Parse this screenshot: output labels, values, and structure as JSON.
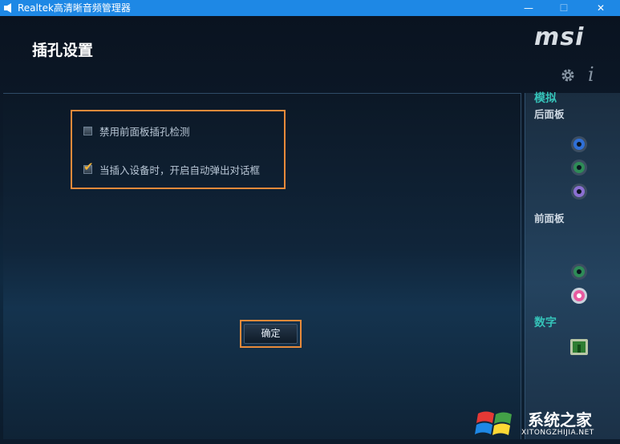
{
  "window": {
    "title": "Realtek高清晰音频管理器",
    "controls": {
      "minimize": "—",
      "maximize": "☐",
      "close": "✕"
    }
  },
  "page": {
    "title": "插孔设置"
  },
  "options": [
    {
      "label": "禁用前面板插孔检测",
      "checked": false
    },
    {
      "label": "当插入设备时，开启自动弹出对话框",
      "checked": true
    }
  ],
  "ok_button": {
    "label": "确定"
  },
  "logo": {
    "text": "msi"
  },
  "side_panel": {
    "analog_heading": "模拟",
    "rear_panel_label": "后面板",
    "rear_jacks": [
      "blue-jack-icon",
      "green-jack-icon",
      "purple-jack-icon"
    ],
    "front_panel_label": "前面板",
    "front_jacks": [
      "green-jack-icon",
      "pink-jack-icon"
    ],
    "digital_heading": "数字",
    "info_symbol": "i"
  },
  "colors": {
    "highlight_border": "#e88a3a",
    "accent_teal": "#35c2b8",
    "titlebar": "#1e88e5",
    "jack_blue": "#2f6fd6",
    "jack_green": "#2e8b57",
    "jack_purple": "#8a6fd1",
    "jack_pink": "#e85aa0"
  },
  "watermark": {
    "text": "系统之家",
    "url": "XITONGZHIJIA.NET"
  }
}
